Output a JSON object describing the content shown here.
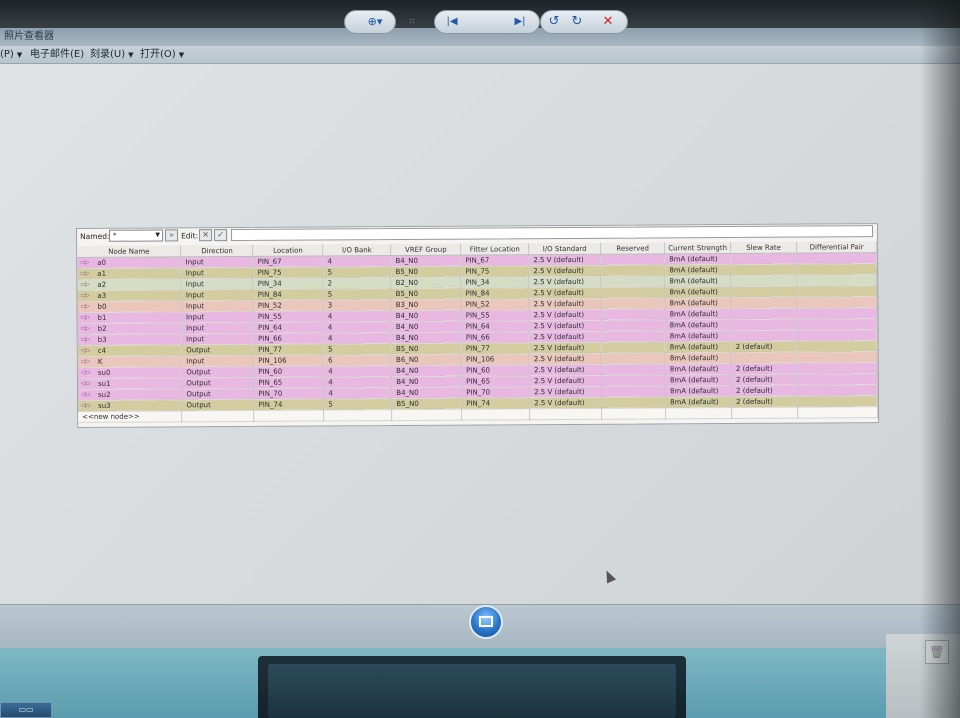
{
  "window": {
    "title": "照片查看器",
    "menu": [
      {
        "label": "(P)"
      },
      {
        "label": "电子邮件(E)"
      },
      {
        "label": "刻录(U)"
      },
      {
        "label": "打开(O)"
      }
    ]
  },
  "pin_planner": {
    "named_label": "Named:",
    "named_value": "*",
    "edit_label": "Edit:",
    "columns": [
      "Node Name",
      "Direction",
      "Location",
      "I/O Bank",
      "VREF Group",
      "Fitter Location",
      "I/O Standard",
      "Reserved",
      "Current Strength",
      "Slew Rate",
      "Differential Pair"
    ],
    "rows": [
      {
        "name": "a0",
        "icon": "input-pin-icon",
        "direction": "Input",
        "location": "PIN_67",
        "bank": "4",
        "vref": "B4_N0",
        "fitter": "PIN_67",
        "standard": "2.5 V (default)",
        "reserved": "",
        "strength": "8mA (default)",
        "slew": "",
        "diff": "",
        "color": "pink"
      },
      {
        "name": "a1",
        "icon": "input-pin-icon",
        "direction": "Input",
        "location": "PIN_75",
        "bank": "5",
        "vref": "B5_N0",
        "fitter": "PIN_75",
        "standard": "2.5 V (default)",
        "reserved": "",
        "strength": "8mA (default)",
        "slew": "",
        "diff": "",
        "color": "olive"
      },
      {
        "name": "a2",
        "icon": "input-pin-icon",
        "direction": "Input",
        "location": "PIN_34",
        "bank": "2",
        "vref": "B2_N0",
        "fitter": "PIN_34",
        "standard": "2.5 V (default)",
        "reserved": "",
        "strength": "8mA (default)",
        "slew": "",
        "diff": "",
        "color": "mint"
      },
      {
        "name": "a3",
        "icon": "input-pin-icon",
        "direction": "Input",
        "location": "PIN_84",
        "bank": "5",
        "vref": "B5_N0",
        "fitter": "PIN_84",
        "standard": "2.5 V (default)",
        "reserved": "",
        "strength": "8mA (default)",
        "slew": "",
        "diff": "",
        "color": "olive"
      },
      {
        "name": "b0",
        "icon": "input-pin-icon",
        "direction": "Input",
        "location": "PIN_52",
        "bank": "3",
        "vref": "B3_N0",
        "fitter": "PIN_52",
        "standard": "2.5 V (default)",
        "reserved": "",
        "strength": "8mA (default)",
        "slew": "",
        "diff": "",
        "color": "peach"
      },
      {
        "name": "b1",
        "icon": "input-pin-icon",
        "direction": "Input",
        "location": "PIN_55",
        "bank": "4",
        "vref": "B4_N0",
        "fitter": "PIN_55",
        "standard": "2.5 V (default)",
        "reserved": "",
        "strength": "8mA (default)",
        "slew": "",
        "diff": "",
        "color": "pink"
      },
      {
        "name": "b2",
        "icon": "input-pin-icon",
        "direction": "Input",
        "location": "PIN_64",
        "bank": "4",
        "vref": "B4_N0",
        "fitter": "PIN_64",
        "standard": "2.5 V (default)",
        "reserved": "",
        "strength": "8mA (default)",
        "slew": "",
        "diff": "",
        "color": "pink"
      },
      {
        "name": "b3",
        "icon": "input-pin-icon",
        "direction": "Input",
        "location": "PIN_66",
        "bank": "4",
        "vref": "B4_N0",
        "fitter": "PIN_66",
        "standard": "2.5 V (default)",
        "reserved": "",
        "strength": "8mA (default)",
        "slew": "",
        "diff": "",
        "color": "pink"
      },
      {
        "name": "c4",
        "icon": "output-pin-icon",
        "direction": "Output",
        "location": "PIN_77",
        "bank": "5",
        "vref": "B5_N0",
        "fitter": "PIN_77",
        "standard": "2.5 V (default)",
        "reserved": "",
        "strength": "8mA (default)",
        "slew": "2 (default)",
        "diff": "",
        "color": "olive"
      },
      {
        "name": "K",
        "icon": "input-pin-icon",
        "direction": "Input",
        "location": "PIN_106",
        "bank": "6",
        "vref": "B6_N0",
        "fitter": "PIN_106",
        "standard": "2.5 V (default)",
        "reserved": "",
        "strength": "8mA (default)",
        "slew": "",
        "diff": "",
        "color": "peach"
      },
      {
        "name": "su0",
        "icon": "output-pin-icon",
        "direction": "Output",
        "location": "PIN_60",
        "bank": "4",
        "vref": "B4_N0",
        "fitter": "PIN_60",
        "standard": "2.5 V (default)",
        "reserved": "",
        "strength": "8mA (default)",
        "slew": "2 (default)",
        "diff": "",
        "color": "pink"
      },
      {
        "name": "su1",
        "icon": "output-pin-icon",
        "direction": "Output",
        "location": "PIN_65",
        "bank": "4",
        "vref": "B4_N0",
        "fitter": "PIN_65",
        "standard": "2.5 V (default)",
        "reserved": "",
        "strength": "8mA (default)",
        "slew": "2 (default)",
        "diff": "",
        "color": "pink"
      },
      {
        "name": "su2",
        "icon": "output-pin-icon",
        "direction": "Output",
        "location": "PIN_70",
        "bank": "4",
        "vref": "B4_N0",
        "fitter": "PIN_70",
        "standard": "2.5 V (default)",
        "reserved": "",
        "strength": "8mA (default)",
        "slew": "2 (default)",
        "diff": "",
        "color": "pink"
      },
      {
        "name": "su3",
        "icon": "output-pin-icon",
        "direction": "Output",
        "location": "PIN_74",
        "bank": "5",
        "vref": "B5_N0",
        "fitter": "PIN_74",
        "standard": "2.5 V (default)",
        "reserved": "",
        "strength": "8mA (default)",
        "slew": "2 (default)",
        "diff": "",
        "color": "olive"
      }
    ],
    "new_node": "<<new node>>"
  },
  "viewer_controls": {
    "buttons": [
      "zoom-icon",
      "fit-window-icon",
      "previous-icon",
      "slideshow-icon",
      "next-icon",
      "rotate-left-icon",
      "rotate-right-icon",
      "delete-icon"
    ],
    "zoom_glyph": "⊕▾",
    "fit_glyph": "⌗",
    "prev_glyph": "|◀",
    "next_glyph": "▶|",
    "rotate_left_glyph": "↺",
    "rotate_right_glyph": "↻",
    "delete_glyph": "✕"
  },
  "colors": {
    "pink": "#e9b8e2",
    "olive": "#d2cc9e",
    "mint": "#d4dcc4",
    "peach": "#ebc6bb"
  }
}
